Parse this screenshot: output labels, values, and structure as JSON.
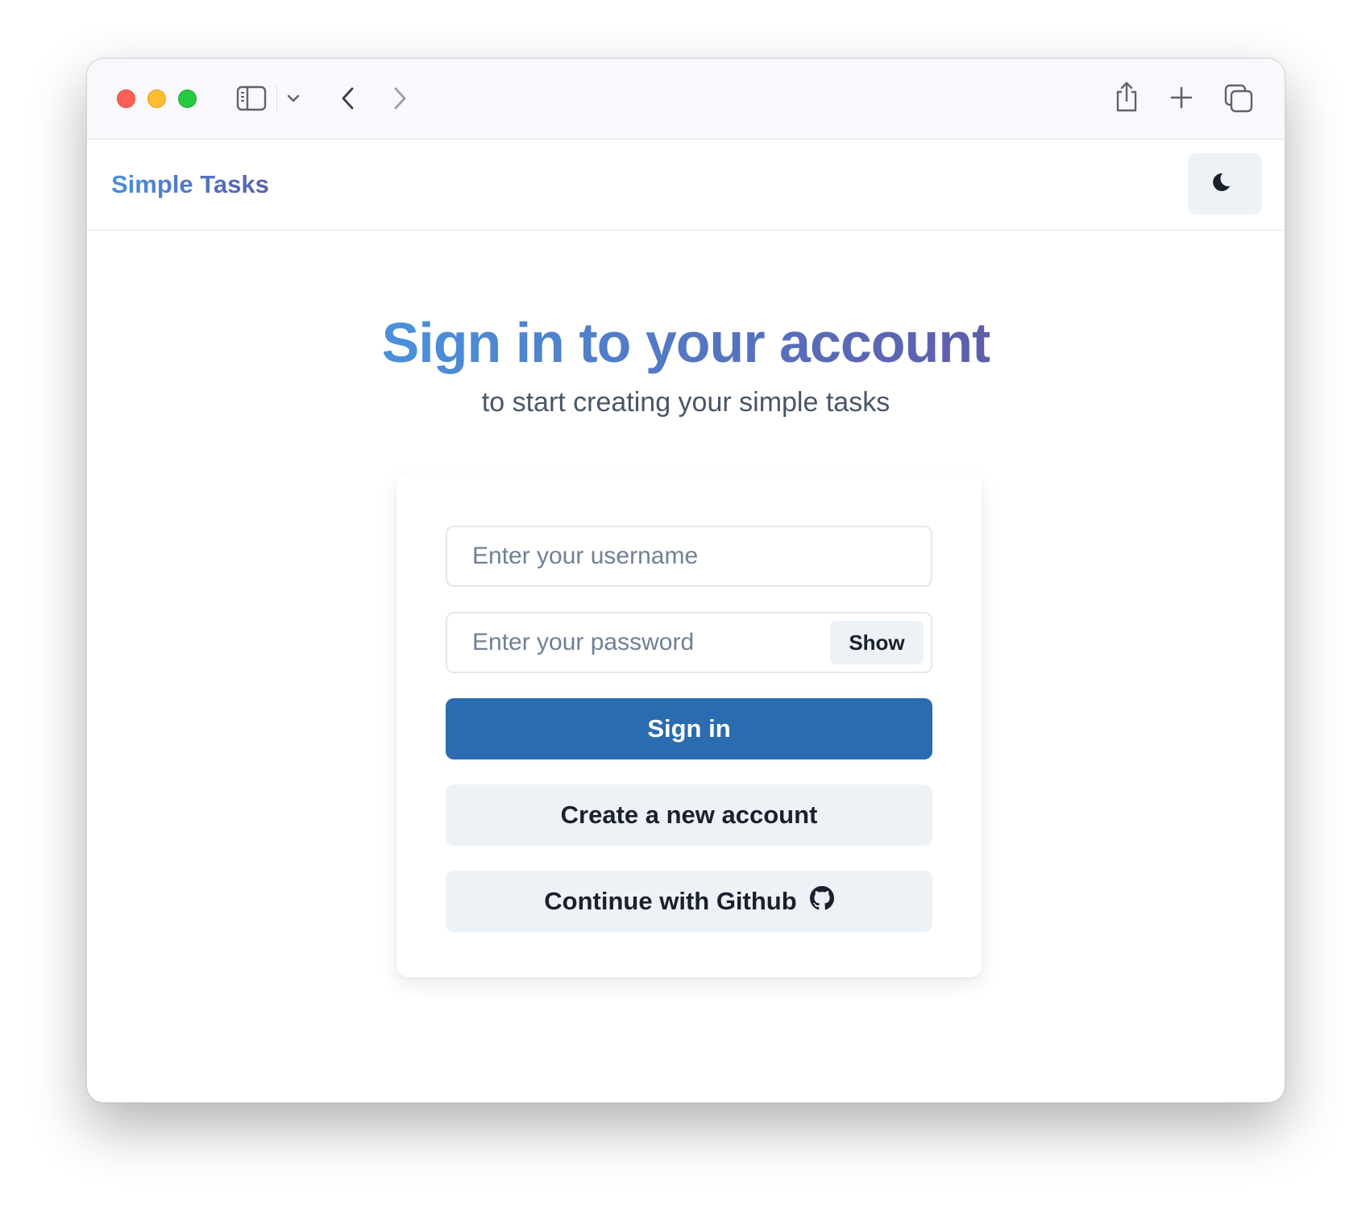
{
  "browser": {
    "icons": [
      "sidebar-icon",
      "chevron-down-icon",
      "back-icon",
      "forward-icon",
      "share-icon",
      "new-tab-icon",
      "tabs-overview-icon"
    ]
  },
  "app": {
    "brand": "Simple Tasks",
    "theme_toggle_icon": "moon-icon"
  },
  "signin": {
    "title": "Sign in to your account",
    "subtitle": "to start creating your simple tasks",
    "username_placeholder": "Enter your username",
    "password_placeholder": "Enter your password",
    "show_label": "Show",
    "signin_label": "Sign in",
    "create_account_label": "Create a new account",
    "github_label": "Continue with Github"
  },
  "colors": {
    "primary": "#2b6cb0",
    "gradient_start": "#4a91db",
    "gradient_end": "#5d5dab",
    "secondary_bg": "#edf2f7"
  }
}
